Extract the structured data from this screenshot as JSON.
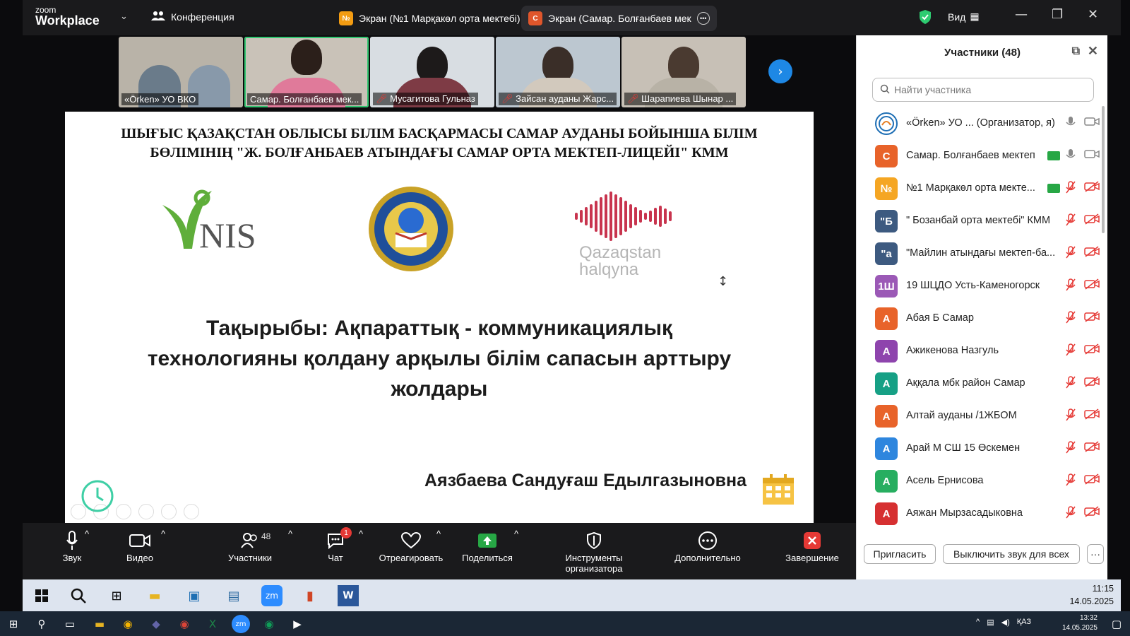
{
  "app": {
    "logo_top": "zoom",
    "logo_bottom": "Workplace"
  },
  "topbar": {
    "conference_label": "Конференция",
    "tabs": [
      {
        "badge": "№",
        "label": "Экран (№1 Марқакөл орта мектебі)"
      },
      {
        "badge": "С",
        "label": "Экран (Самар. Болғанбаев мек"
      }
    ],
    "view_label": "Вид"
  },
  "thumbnails": [
    {
      "name": "«Örken» УО ВКО",
      "muted": false
    },
    {
      "name": "Самар. Болғанбаев мек...",
      "muted": false
    },
    {
      "name": "Мусагитова Гульназ",
      "muted": true
    },
    {
      "name": "Зайсан ауданы Жарс...",
      "muted": true
    },
    {
      "name": "Шарапиева Шынар ...",
      "muted": true
    }
  ],
  "slide": {
    "header_line1": "ШЫҒЫС ҚАЗАҚСТАН ОБЛЫСЫ БІЛІМ БАСҚАРМАСЫ САМАР АУДАНЫ БОЙЫНША БІЛІМ",
    "header_line2": "БӨЛІМІНІҢ \"Ж. БОЛҒАНБАЕВ АТЫНДАҒЫ САМАР ОРТА МЕКТЕП-ЛИЦЕЙІ\" КММ",
    "logo_nis": "NIS",
    "logo_qh_line1": "Qazaqstan",
    "logo_qh_line2": "halqyna",
    "topic_line1": "Тақырыбы: Ақпараттық - коммуникациялық",
    "topic_line2": "технологияны қолдану арқылы білім сапасын арттыру",
    "topic_line3": "жолдары",
    "author": "Аязбаева Сандуғаш Едылгазыновна"
  },
  "toolbar": {
    "audio": "Звук",
    "video": "Видео",
    "participants": "Участники",
    "participants_count": "48",
    "chat": "Чат",
    "chat_badge": "1",
    "react": "Отреагировать",
    "share": "Поделиться",
    "host_tools": "Инструменты организатора",
    "more": "Дополнительно",
    "end": "Завершение"
  },
  "panel": {
    "title": "Участники (48)",
    "search_placeholder": "Найти участника",
    "invite": "Пригласить",
    "mute_all": "Выключить звук для всех",
    "participants": [
      {
        "initial": "",
        "name": "«Örken» УО ...  (Организатор, я)",
        "color": "#ffffff",
        "mic": "on",
        "cam": "on",
        "share": false
      },
      {
        "initial": "С",
        "name": "Самар. Болғанбаев мектеп",
        "color": "#e8632a",
        "mic": "on",
        "cam": "on",
        "share": true
      },
      {
        "initial": "№",
        "name": "№1 Марқакөл орта мекте...",
        "color": "#f5a623",
        "mic": "off",
        "cam": "off",
        "share": true
      },
      {
        "initial": "\"Б",
        "name": "\" Бозанбай орта мектебі\" КММ",
        "color": "#3d5a80",
        "mic": "off",
        "cam": "off",
        "share": false
      },
      {
        "initial": "\"а",
        "name": "\"Майлин атындағы мектеп-ба...",
        "color": "#3d5a80",
        "mic": "off",
        "cam": "off",
        "share": false
      },
      {
        "initial": "1Ш",
        "name": "19 ШЦДО Усть-Каменогорск",
        "color": "#9b59b6",
        "mic": "off",
        "cam": "off",
        "share": false
      },
      {
        "initial": "А",
        "name": "Абая Б Самар",
        "color": "#e8632a",
        "mic": "off",
        "cam": "off",
        "share": false
      },
      {
        "initial": "А",
        "name": "Ажикенова Назгуль",
        "color": "#8e44ad",
        "mic": "off",
        "cam": "off",
        "share": false
      },
      {
        "initial": "А",
        "name": "Аққала мбк район Самар",
        "color": "#16a085",
        "mic": "off",
        "cam": "off",
        "share": false
      },
      {
        "initial": "А",
        "name": "Алтай ауданы  /1ЖБОМ",
        "color": "#e8632a",
        "mic": "off",
        "cam": "off",
        "share": false
      },
      {
        "initial": "А",
        "name": "Арай М СШ 15 Өскемен",
        "color": "#2e86de",
        "mic": "off",
        "cam": "off",
        "share": false
      },
      {
        "initial": "А",
        "name": "Асель Ернисова",
        "color": "#27ae60",
        "mic": "off",
        "cam": "off",
        "share": false
      },
      {
        "initial": "А",
        "name": "Аяжан Мырзасадыковна",
        "color": "#d63031",
        "mic": "off",
        "cam": "off",
        "share": false
      }
    ]
  },
  "taskbar1": {
    "time": "11:15",
    "date": "14.05.2025"
  },
  "taskbar2": {
    "lang": "ҚАЗ",
    "time": "13:32",
    "date": "14.05.2025"
  }
}
